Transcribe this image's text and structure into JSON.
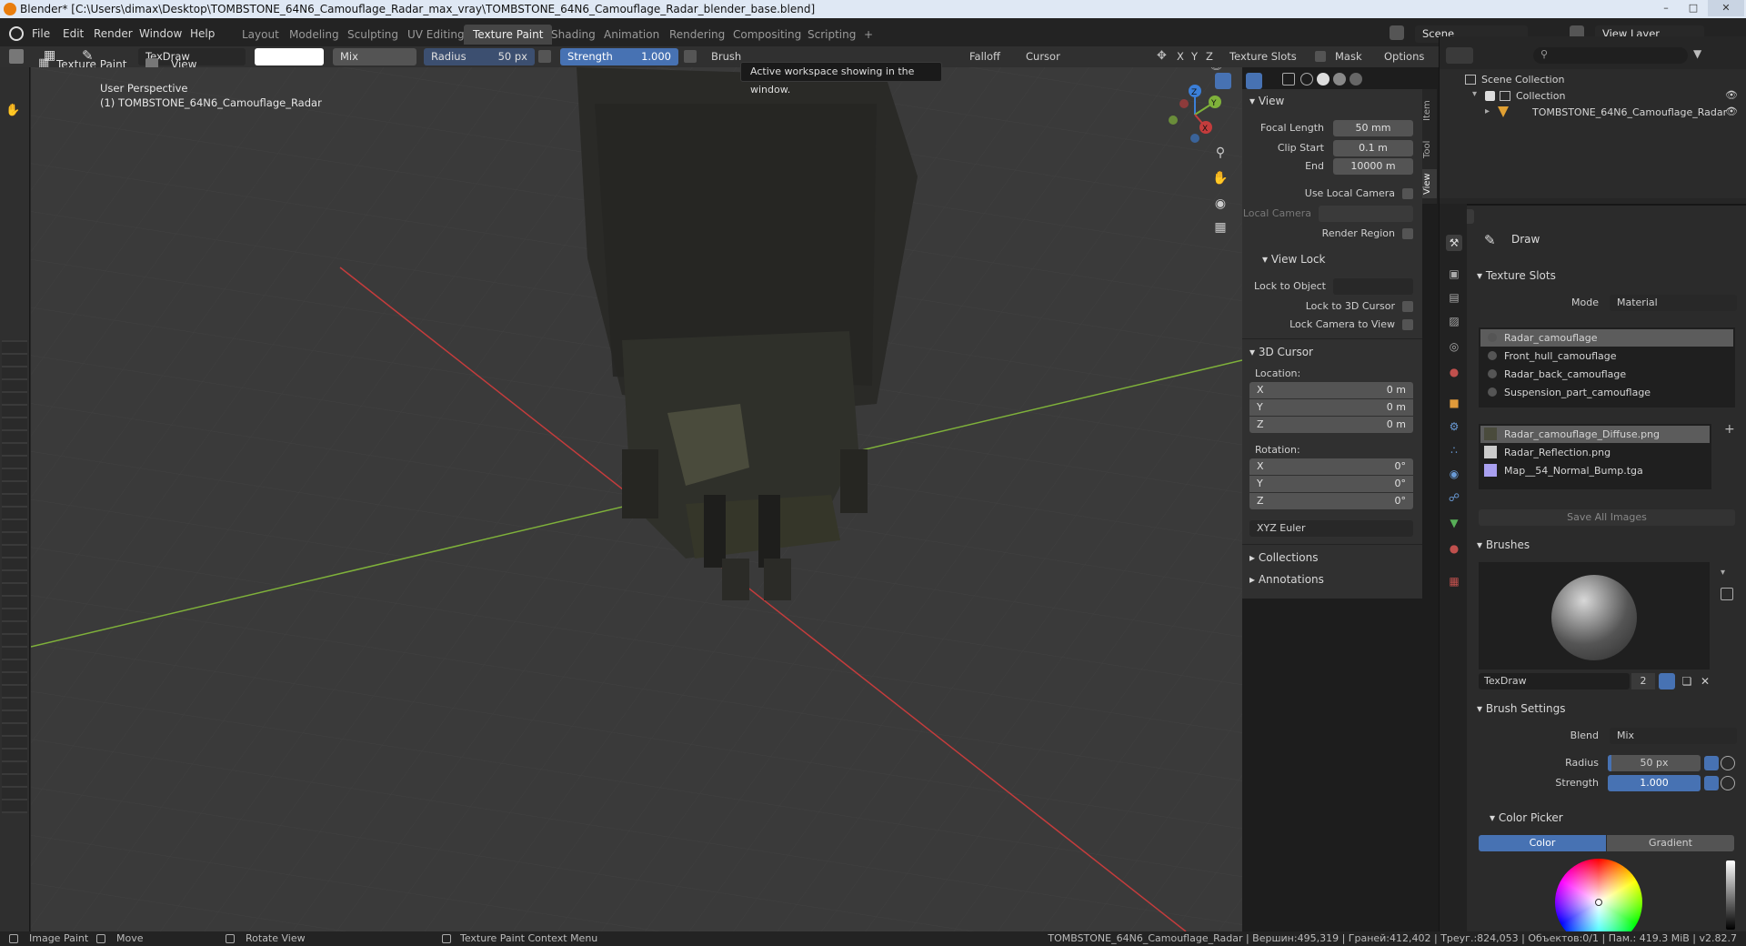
{
  "window": {
    "title": "Blender* [C:\\Users\\dimax\\Desktop\\TOMBSTONE_64N6_Camouflage_Radar_max_vray\\TOMBSTONE_64N6_Camouflage_Radar_blender_base.blend]"
  },
  "menu": [
    "File",
    "Edit",
    "Render",
    "Window",
    "Help"
  ],
  "workspaces": [
    "Layout",
    "Modeling",
    "Sculpting",
    "UV Editing",
    "Texture Paint",
    "Shading",
    "Animation",
    "Rendering",
    "Compositing",
    "Scripting"
  ],
  "workspace_add": "+",
  "scene": {
    "name": "Scene",
    "view_layer": "View Layer"
  },
  "tooltip": "Active workspace showing in the window.",
  "tool_header": {
    "brush_name": "TexDraw",
    "blend": "Mix",
    "radius_label": "Radius",
    "radius_value": "50 px",
    "strength_label": "Strength",
    "strength_value": "1.000",
    "brush_menu": "Brush",
    "falloff": "Falloff",
    "cursor": "Cursor",
    "axes": [
      "X",
      "Y",
      "Z"
    ],
    "texture_slots": "Texture Slots",
    "mask": "Mask",
    "options": "Options"
  },
  "editor_header": {
    "mode": "Texture Paint",
    "view": "View"
  },
  "viewport": {
    "perspective": "User Perspective",
    "object": "(1) TOMBSTONE_64N6_Camouflage_Radar"
  },
  "npanel": {
    "tabs": [
      "Item",
      "Tool",
      "View"
    ],
    "view_section": "View",
    "focal_length_label": "Focal Length",
    "focal_length": "50 mm",
    "clip_start_label": "Clip Start",
    "clip_start": "0.1 m",
    "end_label": "End",
    "clip_end": "10000 m",
    "use_local_camera": "Use Local Camera",
    "local_camera": "Local Camera",
    "render_region": "Render Region",
    "view_lock": "View Lock",
    "lock_to_object": "Lock to Object",
    "lock_to_3d_cursor": "Lock to 3D Cursor",
    "lock_camera_to_view": "Lock Camera to View",
    "cursor_section": "3D Cursor",
    "location_label": "Location:",
    "location": [
      {
        "axis": "X",
        "value": "0 m"
      },
      {
        "axis": "Y",
        "value": "0 m"
      },
      {
        "axis": "Z",
        "value": "0 m"
      }
    ],
    "rotation_label": "Rotation:",
    "rotation": [
      {
        "axis": "X",
        "value": "0°"
      },
      {
        "axis": "Y",
        "value": "0°"
      },
      {
        "axis": "Z",
        "value": "0°"
      }
    ],
    "rotation_mode": "XYZ Euler",
    "collections": "Collections",
    "annotations": "Annotations"
  },
  "outliner": {
    "scene_collection": "Scene Collection",
    "collection": "Collection",
    "object": "TOMBSTONE_64N6_Camouflage_Radar"
  },
  "properties": {
    "tool_name": "Draw",
    "texture_slots": "Texture Slots",
    "mode_label": "Mode",
    "mode": "Material",
    "materials": [
      "Radar_camouflage",
      "Front_hull_camouflage",
      "Radar_back_camouflage",
      "Suspension_part_camouflage"
    ],
    "images": [
      "Radar_camouflage_Diffuse.png",
      "Radar_Reflection.png",
      "Map__54_Normal_Bump.tga"
    ],
    "save_all": "Save All Images",
    "brushes": "Brushes",
    "brush_name": "TexDraw",
    "brush_users": "2",
    "brush_settings": "Brush Settings",
    "blend_label": "Blend",
    "blend": "Mix",
    "radius_label": "Radius",
    "radius": "50 px",
    "strength_label": "Strength",
    "strength": "1.000",
    "color_picker": "Color Picker",
    "color_tab": "Color",
    "gradient_tab": "Gradient"
  },
  "statusbar": {
    "left_action": "Image Paint",
    "move": "Move",
    "rotate": "Rotate View",
    "context": "Texture Paint Context Menu",
    "stats": "TOMBSTONE_64N6_Camouflage_Radar | Вершин:495,319 | Граней:412,402 | Треуг.:824,053 | Объектов:0/1 | Пам.: 419.3 MiB | v2.82.7"
  },
  "colors": {
    "accent": "#4772b3",
    "x_axis": "#c43c3c",
    "y_axis": "#7fb13a",
    "z_axis": "#3b7fd9"
  }
}
